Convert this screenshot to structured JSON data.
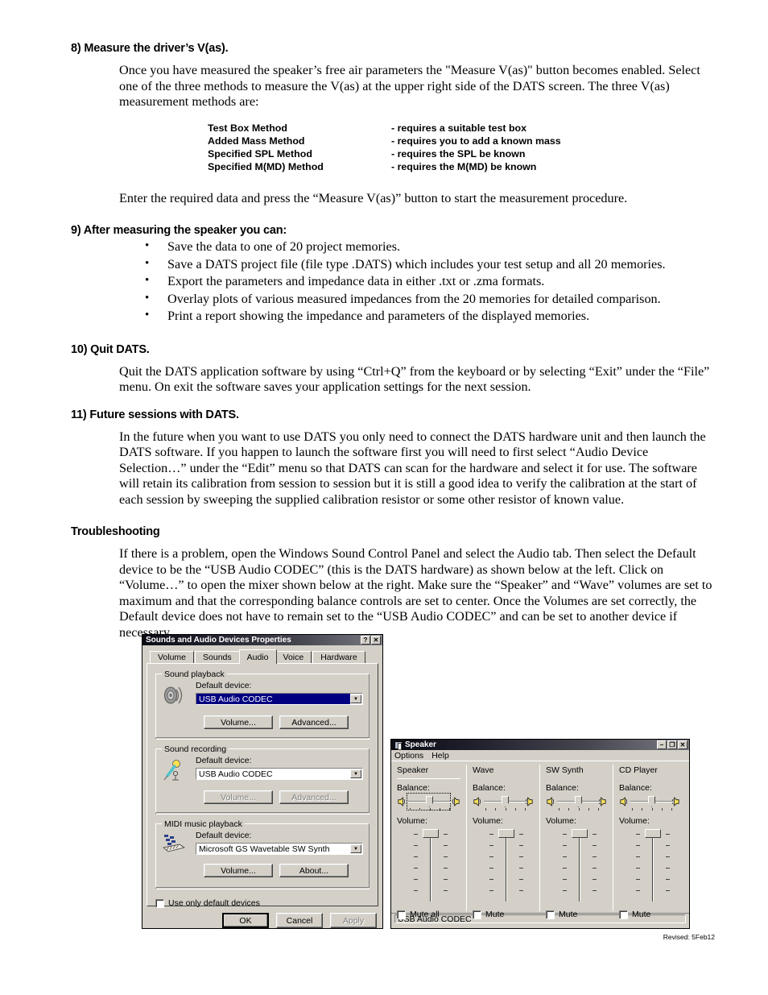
{
  "document": {
    "sections": [
      {
        "id": "sec8",
        "heading": "8) Measure the driver’s V(as).",
        "paragraph": "Once you have measured the speaker’s free air parameters the \"Measure V(as)\" button becomes enabled. Select one of the three methods to measure the V(as) at the upper right side of the DATS screen. The three V(as) measurement methods are:",
        "methods": [
          {
            "name": "Test Box Method",
            "requirement": "- requires a suitable test box"
          },
          {
            "name": "Added Mass Method",
            "requirement": "- requires you to add a known mass"
          },
          {
            "name": "Specified SPL Method",
            "requirement": "- requires the SPL be known"
          },
          {
            "name": "Specified M(MD) Method",
            "requirement": "- requires the M(MD) be known"
          }
        ],
        "closing": "Enter the required data and press the “Measure V(as)” button to start the measurement procedure."
      },
      {
        "id": "sec9",
        "heading": "9) After measuring the speaker you can:",
        "bullets": [
          "Save the data to one of 20 project memories.",
          "Save a DATS project file (file type .DATS) which includes your test setup and all 20 memories.",
          "Export the parameters and impedance data in either .txt or .zma formats.",
          "Overlay plots of various measured impedances from the 20 memories for detailed comparison.",
          "Print a report showing the impedance and parameters of the displayed memories."
        ]
      },
      {
        "id": "sec10",
        "heading": "10) Quit DATS.",
        "paragraph": "Quit the DATS application software by using “Ctrl+Q” from the keyboard or by selecting “Exit” under the “File” menu. On exit the software saves your application settings for the next session."
      },
      {
        "id": "sec11",
        "heading": "11) Future sessions with DATS.",
        "paragraph": "In the future when you want to use DATS you only need to connect the DATS hardware unit and then launch the DATS software. If you happen to launch the software first you will need to first select “Audio Device Selection…” under the “Edit” menu so that DATS can scan for the hardware and select it for use. The software will retain its calibration from session to session but it is still a good idea to verify the calibration at the start of each session by sweeping the supplied calibration resistor or some other resistor of known value."
      },
      {
        "id": "troubleshooting",
        "heading": "Troubleshooting",
        "paragraph": "If there is a problem, open the Windows Sound Control Panel and select the Audio tab. Then select the Default device to be the “USB Audio CODEC” (this is the DATS hardware) as shown below at the left. Click on “Volume…” to open the mixer shown below at the right. Make sure the “Speaker” and “Wave” volumes are set to maximum and that the corresponding balance controls are set to center. Once the Volumes are set correctly, the Default device does not have to remain set to the “USB Audio CODEC” and can be set to another device if necessary."
      }
    ],
    "footer": "Revised: 5Feb12"
  },
  "sounds_dialog": {
    "title": "Sounds and Audio Devices Properties",
    "titlebar_buttons": {
      "help": "?",
      "close": "✕"
    },
    "tabs": [
      {
        "label": "Volume",
        "active": false
      },
      {
        "label": "Sounds",
        "active": false
      },
      {
        "label": "Audio",
        "active": true
      },
      {
        "label": "Voice",
        "active": false
      },
      {
        "label": "Hardware",
        "active": false
      }
    ],
    "groups": [
      {
        "legend": "Sound playback",
        "icon": "speaker-icon",
        "device_label": "Default device:",
        "device_value": "USB Audio CODEC",
        "device_selected": true,
        "buttons": [
          {
            "label": "Volume...",
            "disabled": false
          },
          {
            "label": "Advanced...",
            "disabled": false
          }
        ]
      },
      {
        "legend": "Sound recording",
        "icon": "microphone-icon",
        "device_label": "Default device:",
        "device_value": "USB Audio CODEC",
        "device_selected": false,
        "buttons": [
          {
            "label": "Volume...",
            "disabled": true
          },
          {
            "label": "Advanced...",
            "disabled": true
          }
        ]
      },
      {
        "legend": "MIDI music playback",
        "icon": "midi-keyboard-icon",
        "device_label": "Default device:",
        "device_value": "Microsoft GS Wavetable SW Synth",
        "device_selected": false,
        "buttons": [
          {
            "label": "Volume...",
            "disabled": false
          },
          {
            "label": "About...",
            "disabled": false
          }
        ]
      }
    ],
    "checkbox": {
      "label": "Use only default devices",
      "checked": false
    },
    "footer_buttons": [
      {
        "label": "OK",
        "default": true,
        "disabled": false
      },
      {
        "label": "Cancel",
        "default": false,
        "disabled": false
      },
      {
        "label": "Apply",
        "default": false,
        "disabled": true
      }
    ]
  },
  "mixer_window": {
    "title": "Speaker",
    "titlebar_buttons": {
      "minimize": "–",
      "maximize": "❐",
      "close": "✕"
    },
    "menus": [
      "Options",
      "Help"
    ],
    "columns": [
      {
        "title": "Speaker",
        "balance_label": "Balance:",
        "volume_label": "Volume:",
        "mute_label": "Mute all",
        "muted": false,
        "balance_focused": true,
        "balance_pct": 50,
        "volume_pct": 100
      },
      {
        "title": "Wave",
        "balance_label": "Balance:",
        "volume_label": "Volume:",
        "mute_label": "Mute",
        "muted": false,
        "balance_focused": false,
        "balance_pct": 50,
        "volume_pct": 100
      },
      {
        "title": "SW Synth",
        "balance_label": "Balance:",
        "volume_label": "Volume:",
        "mute_label": "Mute",
        "muted": false,
        "balance_focused": false,
        "balance_pct": 50,
        "volume_pct": 100
      },
      {
        "title": "CD Player",
        "balance_label": "Balance:",
        "volume_label": "Volume:",
        "mute_label": "Mute",
        "muted": false,
        "balance_focused": false,
        "balance_pct": 50,
        "volume_pct": 100
      }
    ],
    "status": "USB Audio CODEC"
  },
  "colors": {
    "dialog_face": "#d4d0c8",
    "selection_blue": "#000080",
    "titlebar_dark": "#0b0b14",
    "page_background": "#ffffff"
  }
}
